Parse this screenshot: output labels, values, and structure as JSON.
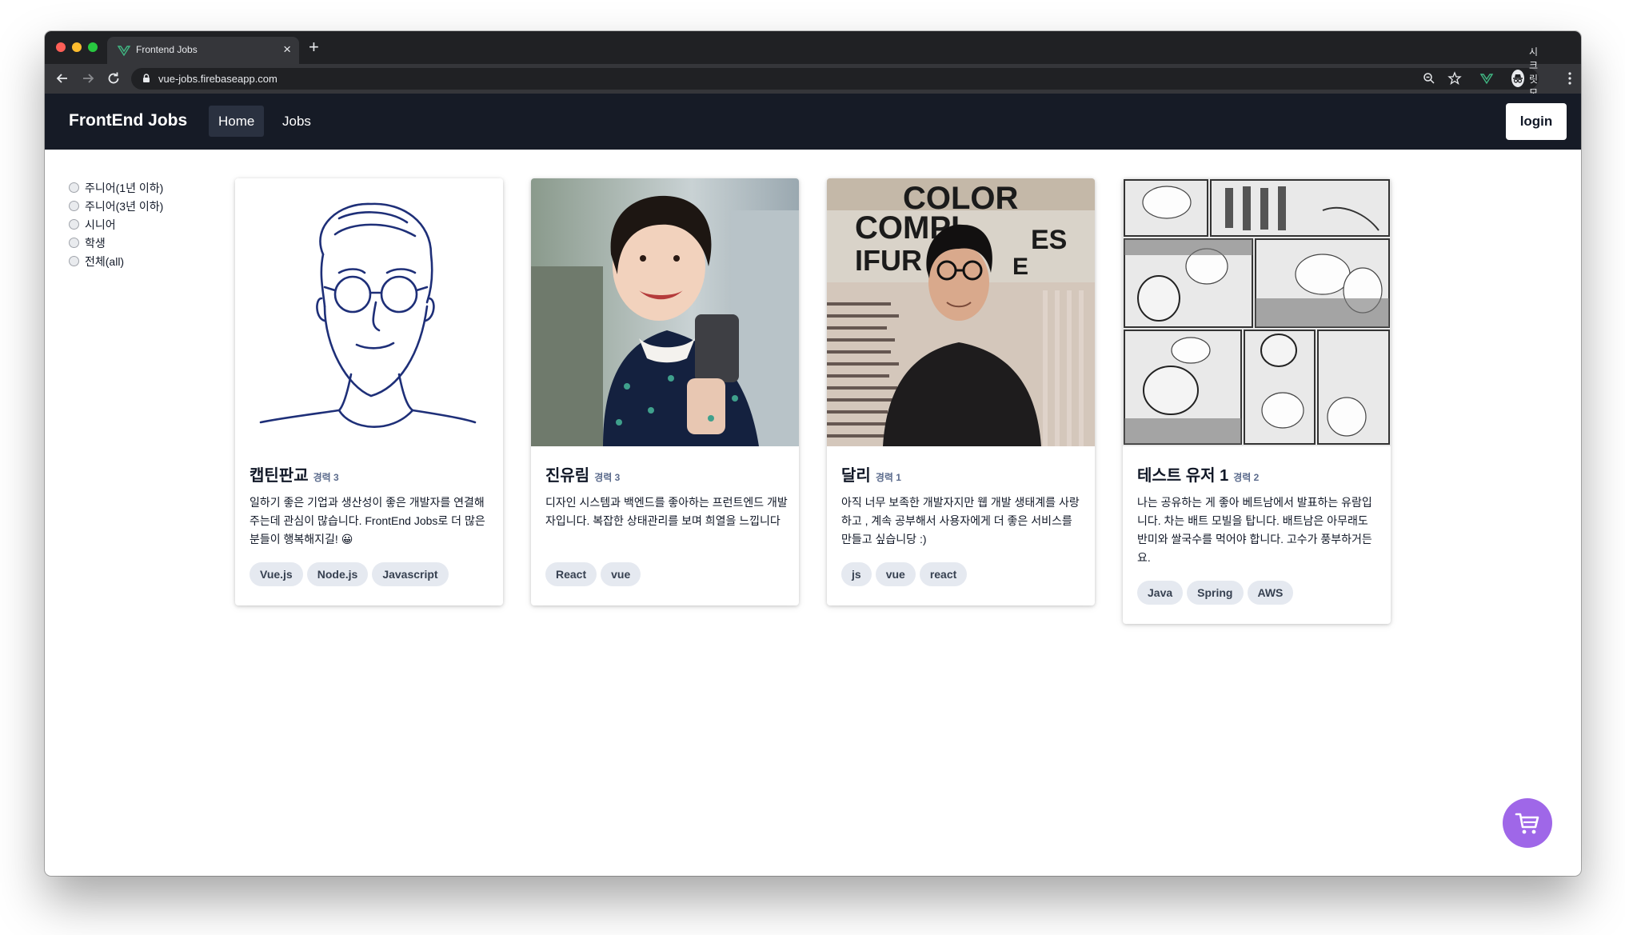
{
  "browser": {
    "tab_title": "Frontend Jobs",
    "tab_close": "×",
    "new_tab": "+",
    "url": "vue-jobs.firebaseapp.com",
    "incognito_label": "시크릿 모드"
  },
  "nav": {
    "brand": "FrontEnd Jobs",
    "links": [
      {
        "label": "Home",
        "active": true
      },
      {
        "label": "Jobs",
        "active": false
      }
    ],
    "login_label": "login"
  },
  "filters": [
    {
      "label": "주니어(1년 이하)"
    },
    {
      "label": "주니어(3년 이하)"
    },
    {
      "label": "시니어"
    },
    {
      "label": "학생"
    },
    {
      "label": "전체(all)"
    }
  ],
  "cards": [
    {
      "name": "캡틴판교",
      "exp": "경력 3",
      "description": "일하기 좋은 기업과 생산성이 좋은 개발자를 연결해주는데 관심이 많습니다. FrontEnd Jobs로 더 많은 분들이 행복해지길! 😀",
      "tags": [
        "Vue.js",
        "Node.js",
        "Javascript"
      ],
      "image": "line-drawing-portrait"
    },
    {
      "name": "진유림",
      "exp": "경력 3",
      "description": "디자인 시스템과 백엔드를 좋아하는 프런트엔드 개발자입니다. 복잡한 상태관리를 보며 희열을 느낍니다",
      "tags": [
        "React",
        "vue"
      ],
      "image": "photo-portrait"
    },
    {
      "name": "달리",
      "exp": "경력 1",
      "description": "아직 너무 보족한 개발자지만 웹 개발 생태계를 사랑하고 , 계속 공부해서 사용자에게 더 좋은 서비스를 만들고 싶습니당 :)",
      "tags": [
        "js",
        "vue",
        "react"
      ],
      "image": "photo-portrait",
      "image_text": [
        "COLOR",
        "COMPL",
        "ES",
        "IFUR",
        "E"
      ]
    },
    {
      "name": "테스트 유저 1",
      "exp": "경력 2",
      "description": "나는 공유하는 게 좋아 베트남에서 발표하는 유람입니다. 차는 배트 모빌을 탑니다. 배트남은 아무래도 반미와 쌀국수를 먹어야 합니다. 고수가 풍부하거든요.",
      "tags": [
        "Java",
        "Spring",
        "AWS"
      ],
      "image": "manga-panel"
    }
  ],
  "colors": {
    "chrome_dark": "#202124",
    "nav_bg": "#161b26",
    "cart_bg": "#9f67e8",
    "tag_bg": "#e5e9f0"
  },
  "icons": [
    "back-arrow-icon",
    "forward-arrow-icon",
    "reload-icon",
    "lock-icon",
    "zoom-icon",
    "star-icon",
    "extension-icon",
    "incognito-icon",
    "more-menu-icon",
    "cart-icon"
  ]
}
